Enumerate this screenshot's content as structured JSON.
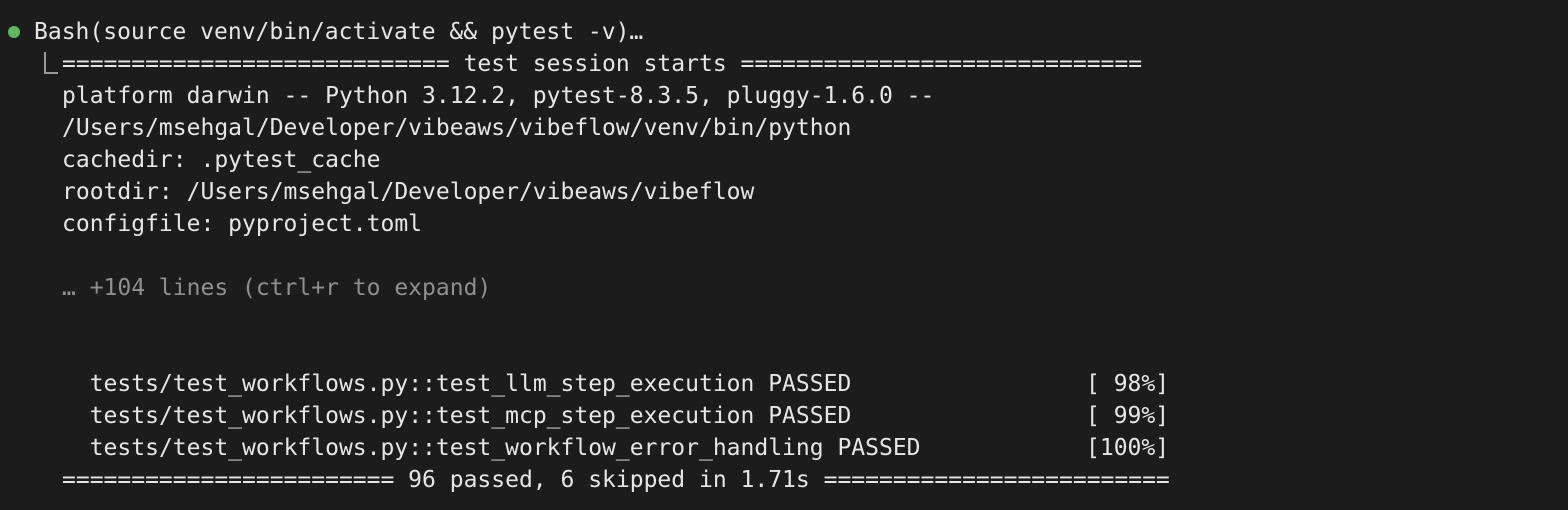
{
  "colors": {
    "background": "#1c1c1c",
    "text": "#e6e6e6",
    "dim_text": "#8f8f8f",
    "status_dot": "#5db860"
  },
  "command": {
    "status_icon": "green-dot-icon",
    "text": "Bash(source venv/bin/activate && pytest -v)…"
  },
  "output": {
    "header": "============================ test session starts =============================",
    "platform_line_1": "platform darwin -- Python 3.12.2, pytest-8.3.5, pluggy-1.6.0 --",
    "platform_line_2": "/Users/msehgal/Developer/vibeaws/vibeflow/venv/bin/python",
    "cachedir": "cachedir: .pytest_cache",
    "rootdir": "rootdir: /Users/msehgal/Developer/vibeaws/vibeflow",
    "configfile": "configfile: pyproject.toml",
    "collapsed": "… +104 lines (ctrl+r to expand)",
    "tests": [
      {
        "name": "tests/test_workflows.py::test_llm_step_execution PASSED",
        "progress": "[ 98%]"
      },
      {
        "name": "tests/test_workflows.py::test_mcp_step_execution PASSED",
        "progress": "[ 99%]"
      },
      {
        "name": "tests/test_workflows.py::test_workflow_error_handling PASSED",
        "progress": "[100%]"
      }
    ],
    "summary": "======================== 96 passed, 6 skipped in 1.71s ========================="
  }
}
